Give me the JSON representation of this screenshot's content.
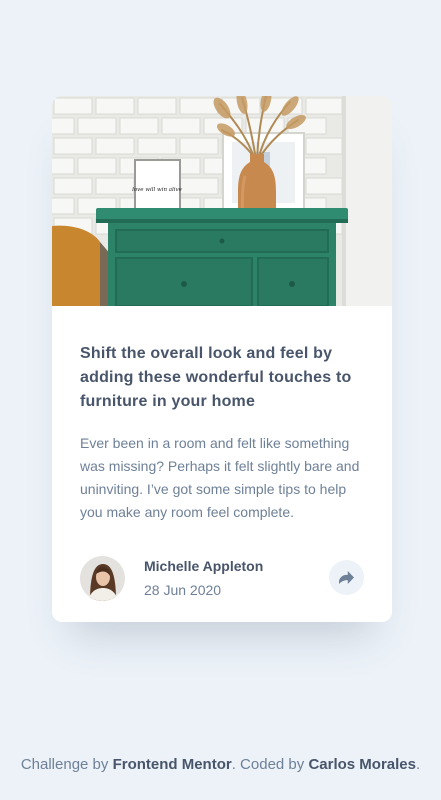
{
  "card": {
    "image_alt": "drawers",
    "frame_text": "love will win alive",
    "title": "Shift the overall look and feel by adding these wonderful touches to furniture in your home",
    "description": "Ever been in a room and felt like something was missing? Perhaps it felt slightly bare and uninviting. I’ve got some simple tips to help you make any room feel complete.",
    "author": {
      "name": "Michelle Appleton",
      "date": "28 Jun 2020"
    },
    "share_icon": "share-icon"
  },
  "attribution": {
    "prefix": "Challenge by ",
    "link1": "Frontend Mentor",
    "middle": ". Coded by ",
    "link2": "Carlos Morales",
    "suffix": "."
  },
  "colors": {
    "background": "#ecf2f8",
    "title": "#48556a",
    "body": "#6e8098",
    "drawer_green": "#2c8368"
  }
}
